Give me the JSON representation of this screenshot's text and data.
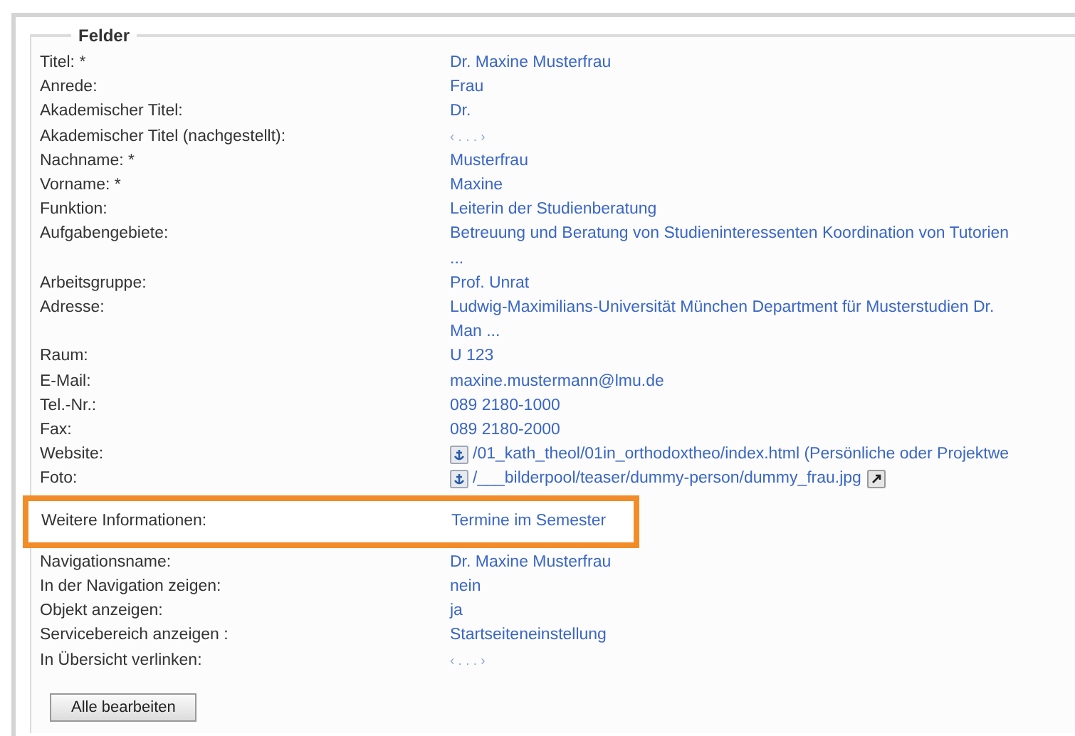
{
  "fieldset": {
    "legend": "Felder",
    "rows": [
      {
        "label": "Titel: *",
        "kind": "text",
        "value": "Dr. Maxine Musterfrau"
      },
      {
        "label": "Anrede:",
        "kind": "text",
        "value": "Frau"
      },
      {
        "label": "Akademischer Titel:",
        "kind": "text",
        "value": "Dr."
      },
      {
        "label": "Akademischer Titel (nachgestellt):",
        "kind": "empty",
        "value": "‹ . . . ›"
      },
      {
        "label": "Nachname: *",
        "kind": "text",
        "value": "Musterfrau"
      },
      {
        "label": "Vorname: *",
        "kind": "text",
        "value": "Maxine"
      },
      {
        "label": "Funktion:",
        "kind": "text",
        "value": "Leiterin der Studienberatung"
      },
      {
        "label": "Aufgabengebiete:",
        "kind": "text",
        "value": "Betreuung und Beratung von Studieninteressenten Koordination von Tutorien ..."
      },
      {
        "label": "Arbeitsgruppe:",
        "kind": "text",
        "value": "Prof. Unrat"
      },
      {
        "label": "Adresse:",
        "kind": "text",
        "value": "Ludwig-Maximilians-Universität München Department für Musterstudien Dr. Man ..."
      },
      {
        "label": "Raum:",
        "kind": "text",
        "value": "U 123"
      },
      {
        "label": "E-Mail:",
        "kind": "text",
        "value": "maxine.mustermann@lmu.de"
      },
      {
        "label": "Tel.-Nr.:",
        "kind": "text",
        "value": "089 2180-1000"
      },
      {
        "label": "Fax:",
        "kind": "text",
        "value": "089 2180-2000"
      },
      {
        "label": "Website:",
        "kind": "link",
        "value": "/01_kath_theol/01in_orthodoxtheo/index.html (Persönliche oder Projektwe"
      },
      {
        "label": "Foto:",
        "kind": "file",
        "value": "/___bilderpool/teaser/dummy-person/dummy_frau.jpg"
      },
      {
        "label": "Weitere Informationen:",
        "kind": "text",
        "value": "Termine im Semester",
        "highlighted": true
      },
      {
        "label": "Navigationsname:",
        "kind": "text",
        "value": "Dr. Maxine Musterfrau"
      },
      {
        "label": "In der Navigation zeigen:",
        "kind": "text",
        "value": "nein"
      },
      {
        "label": "Objekt anzeigen:",
        "kind": "text",
        "value": "ja"
      },
      {
        "label": "Servicebereich anzeigen :",
        "kind": "text",
        "value": "Startseiteneinstellung"
      },
      {
        "label": "In Übersicht verlinken:",
        "kind": "empty",
        "value": "‹ . . . ›"
      }
    ],
    "button": "Alle bearbeiten"
  }
}
